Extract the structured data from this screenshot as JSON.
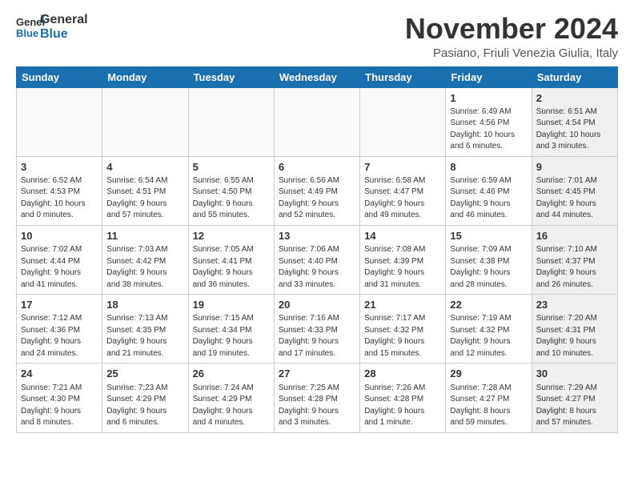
{
  "header": {
    "logo_line1": "General",
    "logo_line2": "Blue",
    "month_title": "November 2024",
    "location": "Pasiano, Friuli Venezia Giulia, Italy"
  },
  "days_of_week": [
    "Sunday",
    "Monday",
    "Tuesday",
    "Wednesday",
    "Thursday",
    "Friday",
    "Saturday"
  ],
  "weeks": [
    [
      {
        "day": "",
        "info": "",
        "shaded": false
      },
      {
        "day": "",
        "info": "",
        "shaded": false
      },
      {
        "day": "",
        "info": "",
        "shaded": false
      },
      {
        "day": "",
        "info": "",
        "shaded": false
      },
      {
        "day": "",
        "info": "",
        "shaded": false
      },
      {
        "day": "1",
        "info": "Sunrise: 6:49 AM\nSunset: 4:56 PM\nDaylight: 10 hours\nand 6 minutes.",
        "shaded": false
      },
      {
        "day": "2",
        "info": "Sunrise: 6:51 AM\nSunset: 4:54 PM\nDaylight: 10 hours\nand 3 minutes.",
        "shaded": true
      }
    ],
    [
      {
        "day": "3",
        "info": "Sunrise: 6:52 AM\nSunset: 4:53 PM\nDaylight: 10 hours\nand 0 minutes.",
        "shaded": false
      },
      {
        "day": "4",
        "info": "Sunrise: 6:54 AM\nSunset: 4:51 PM\nDaylight: 9 hours\nand 57 minutes.",
        "shaded": false
      },
      {
        "day": "5",
        "info": "Sunrise: 6:55 AM\nSunset: 4:50 PM\nDaylight: 9 hours\nand 55 minutes.",
        "shaded": false
      },
      {
        "day": "6",
        "info": "Sunrise: 6:56 AM\nSunset: 4:49 PM\nDaylight: 9 hours\nand 52 minutes.",
        "shaded": false
      },
      {
        "day": "7",
        "info": "Sunrise: 6:58 AM\nSunset: 4:47 PM\nDaylight: 9 hours\nand 49 minutes.",
        "shaded": false
      },
      {
        "day": "8",
        "info": "Sunrise: 6:59 AM\nSunset: 4:46 PM\nDaylight: 9 hours\nand 46 minutes.",
        "shaded": false
      },
      {
        "day": "9",
        "info": "Sunrise: 7:01 AM\nSunset: 4:45 PM\nDaylight: 9 hours\nand 44 minutes.",
        "shaded": true
      }
    ],
    [
      {
        "day": "10",
        "info": "Sunrise: 7:02 AM\nSunset: 4:44 PM\nDaylight: 9 hours\nand 41 minutes.",
        "shaded": false
      },
      {
        "day": "11",
        "info": "Sunrise: 7:03 AM\nSunset: 4:42 PM\nDaylight: 9 hours\nand 38 minutes.",
        "shaded": false
      },
      {
        "day": "12",
        "info": "Sunrise: 7:05 AM\nSunset: 4:41 PM\nDaylight: 9 hours\nand 36 minutes.",
        "shaded": false
      },
      {
        "day": "13",
        "info": "Sunrise: 7:06 AM\nSunset: 4:40 PM\nDaylight: 9 hours\nand 33 minutes.",
        "shaded": false
      },
      {
        "day": "14",
        "info": "Sunrise: 7:08 AM\nSunset: 4:39 PM\nDaylight: 9 hours\nand 31 minutes.",
        "shaded": false
      },
      {
        "day": "15",
        "info": "Sunrise: 7:09 AM\nSunset: 4:38 PM\nDaylight: 9 hours\nand 28 minutes.",
        "shaded": false
      },
      {
        "day": "16",
        "info": "Sunrise: 7:10 AM\nSunset: 4:37 PM\nDaylight: 9 hours\nand 26 minutes.",
        "shaded": true
      }
    ],
    [
      {
        "day": "17",
        "info": "Sunrise: 7:12 AM\nSunset: 4:36 PM\nDaylight: 9 hours\nand 24 minutes.",
        "shaded": false
      },
      {
        "day": "18",
        "info": "Sunrise: 7:13 AM\nSunset: 4:35 PM\nDaylight: 9 hours\nand 21 minutes.",
        "shaded": false
      },
      {
        "day": "19",
        "info": "Sunrise: 7:15 AM\nSunset: 4:34 PM\nDaylight: 9 hours\nand 19 minutes.",
        "shaded": false
      },
      {
        "day": "20",
        "info": "Sunrise: 7:16 AM\nSunset: 4:33 PM\nDaylight: 9 hours\nand 17 minutes.",
        "shaded": false
      },
      {
        "day": "21",
        "info": "Sunrise: 7:17 AM\nSunset: 4:32 PM\nDaylight: 9 hours\nand 15 minutes.",
        "shaded": false
      },
      {
        "day": "22",
        "info": "Sunrise: 7:19 AM\nSunset: 4:32 PM\nDaylight: 9 hours\nand 12 minutes.",
        "shaded": false
      },
      {
        "day": "23",
        "info": "Sunrise: 7:20 AM\nSunset: 4:31 PM\nDaylight: 9 hours\nand 10 minutes.",
        "shaded": true
      }
    ],
    [
      {
        "day": "24",
        "info": "Sunrise: 7:21 AM\nSunset: 4:30 PM\nDaylight: 9 hours\nand 8 minutes.",
        "shaded": false
      },
      {
        "day": "25",
        "info": "Sunrise: 7:23 AM\nSunset: 4:29 PM\nDaylight: 9 hours\nand 6 minutes.",
        "shaded": false
      },
      {
        "day": "26",
        "info": "Sunrise: 7:24 AM\nSunset: 4:29 PM\nDaylight: 9 hours\nand 4 minutes.",
        "shaded": false
      },
      {
        "day": "27",
        "info": "Sunrise: 7:25 AM\nSunset: 4:28 PM\nDaylight: 9 hours\nand 3 minutes.",
        "shaded": false
      },
      {
        "day": "28",
        "info": "Sunrise: 7:26 AM\nSunset: 4:28 PM\nDaylight: 9 hours\nand 1 minute.",
        "shaded": false
      },
      {
        "day": "29",
        "info": "Sunrise: 7:28 AM\nSunset: 4:27 PM\nDaylight: 8 hours\nand 59 minutes.",
        "shaded": false
      },
      {
        "day": "30",
        "info": "Sunrise: 7:29 AM\nSunset: 4:27 PM\nDaylight: 8 hours\nand 57 minutes.",
        "shaded": true
      }
    ]
  ]
}
